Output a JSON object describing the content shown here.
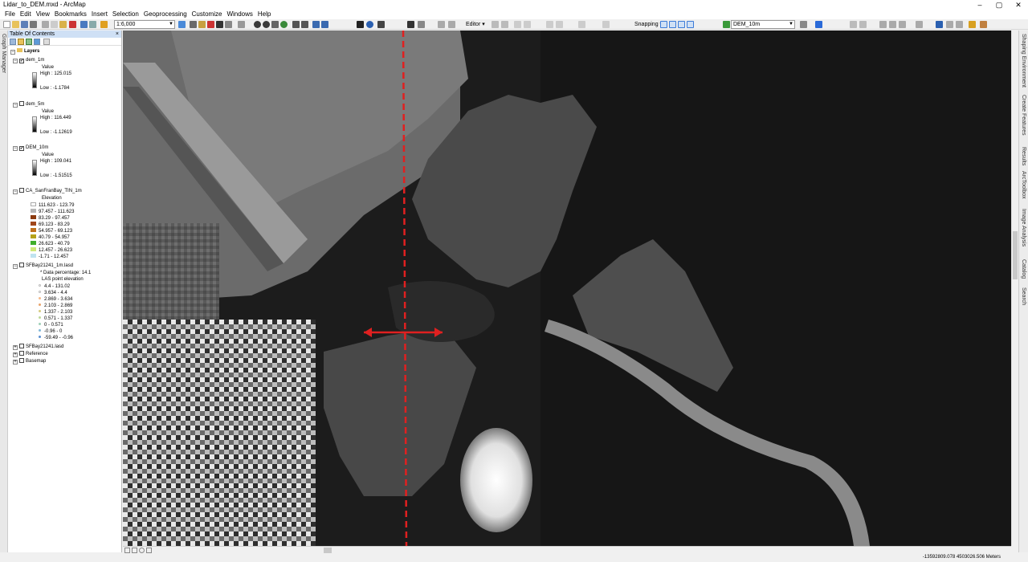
{
  "window": {
    "title": "Lidar_to_DEM.mxd - ArcMap",
    "min": "–",
    "max": "▢",
    "close": "✕"
  },
  "menu": [
    "File",
    "Edit",
    "View",
    "Bookmarks",
    "Insert",
    "Selection",
    "Geoprocessing",
    "Customize",
    "Windows",
    "Help"
  ],
  "toolbar": {
    "scale": "1:6,000",
    "editor": "Editor ▾",
    "snapping": "Snapping ▾",
    "target_layer": "DEM_10m"
  },
  "left_strip": {
    "label": "Graph Manager"
  },
  "toc": {
    "title": "Table Of Contents",
    "close": "×",
    "root": "Layers",
    "layers": [
      {
        "name": "dem_1m",
        "checked": true,
        "field": "Value",
        "high": "High : 125.015",
        "low": "Low : -1.1784"
      },
      {
        "name": "dem_5m",
        "checked": false,
        "field": "Value",
        "high": "High : 116.449",
        "low": "Low : -1.12619"
      },
      {
        "name": "DEM_10m",
        "checked": true,
        "field": "Value",
        "high": "High : 109.041",
        "low": "Low : -1.51515"
      }
    ],
    "tin": {
      "name": "CA_SanFranBay_TIN_1m",
      "field": "Elevation",
      "classes": [
        {
          "label": "111.623 - 123.79",
          "color": "#ffffff"
        },
        {
          "label": "97.457 - 111.623",
          "color": "#b5b5b5"
        },
        {
          "label": "83.29 - 97.457",
          "color": "#8b3a0f"
        },
        {
          "label": "69.123 - 83.29",
          "color": "#a0461a"
        },
        {
          "label": "54.957 - 69.123",
          "color": "#c0701c"
        },
        {
          "label": "40.79 - 54.957",
          "color": "#b5a21a"
        },
        {
          "label": "26.623 - 40.79",
          "color": "#3fae2a"
        },
        {
          "label": "12.457 - 26.623",
          "color": "#cfe87a"
        },
        {
          "label": "-1.71 - 12.457",
          "color": "#bfe3f0"
        }
      ]
    },
    "las": {
      "name": "SFBay21241_1m.lasd",
      "note": "* Data percentage: 14.1",
      "field": "LAS point elevation",
      "classes": [
        {
          "label": "4.4 - 131.02",
          "color": "#ffffff"
        },
        {
          "label": "3.634 - 4.4",
          "color": "#ffffff"
        },
        {
          "label": "2.869 - 3.634",
          "color": "#f4b98a"
        },
        {
          "label": "2.103 - 2.869",
          "color": "#e9a36a"
        },
        {
          "label": "1.337 - 2.103",
          "color": "#d6cc80"
        },
        {
          "label": "0.571 - 1.337",
          "color": "#bcd99a"
        },
        {
          "label": "0 - 0.571",
          "color": "#9fd0b8"
        },
        {
          "label": "-0.96 - 0",
          "color": "#80b8d8"
        },
        {
          "label": "-59.49 - -0.96",
          "color": "#5a8fd0"
        }
      ]
    },
    "others": [
      "SFBay21241.lasd",
      "Reference",
      "Basemap"
    ]
  },
  "right_strip": [
    "Shaping Environment",
    "Create Features",
    "Results",
    "ArcToolbox",
    "Image Analysis",
    "Catalog",
    "Search"
  ],
  "status": {
    "coords": "-13592809.078  4503026.506 Meters"
  }
}
